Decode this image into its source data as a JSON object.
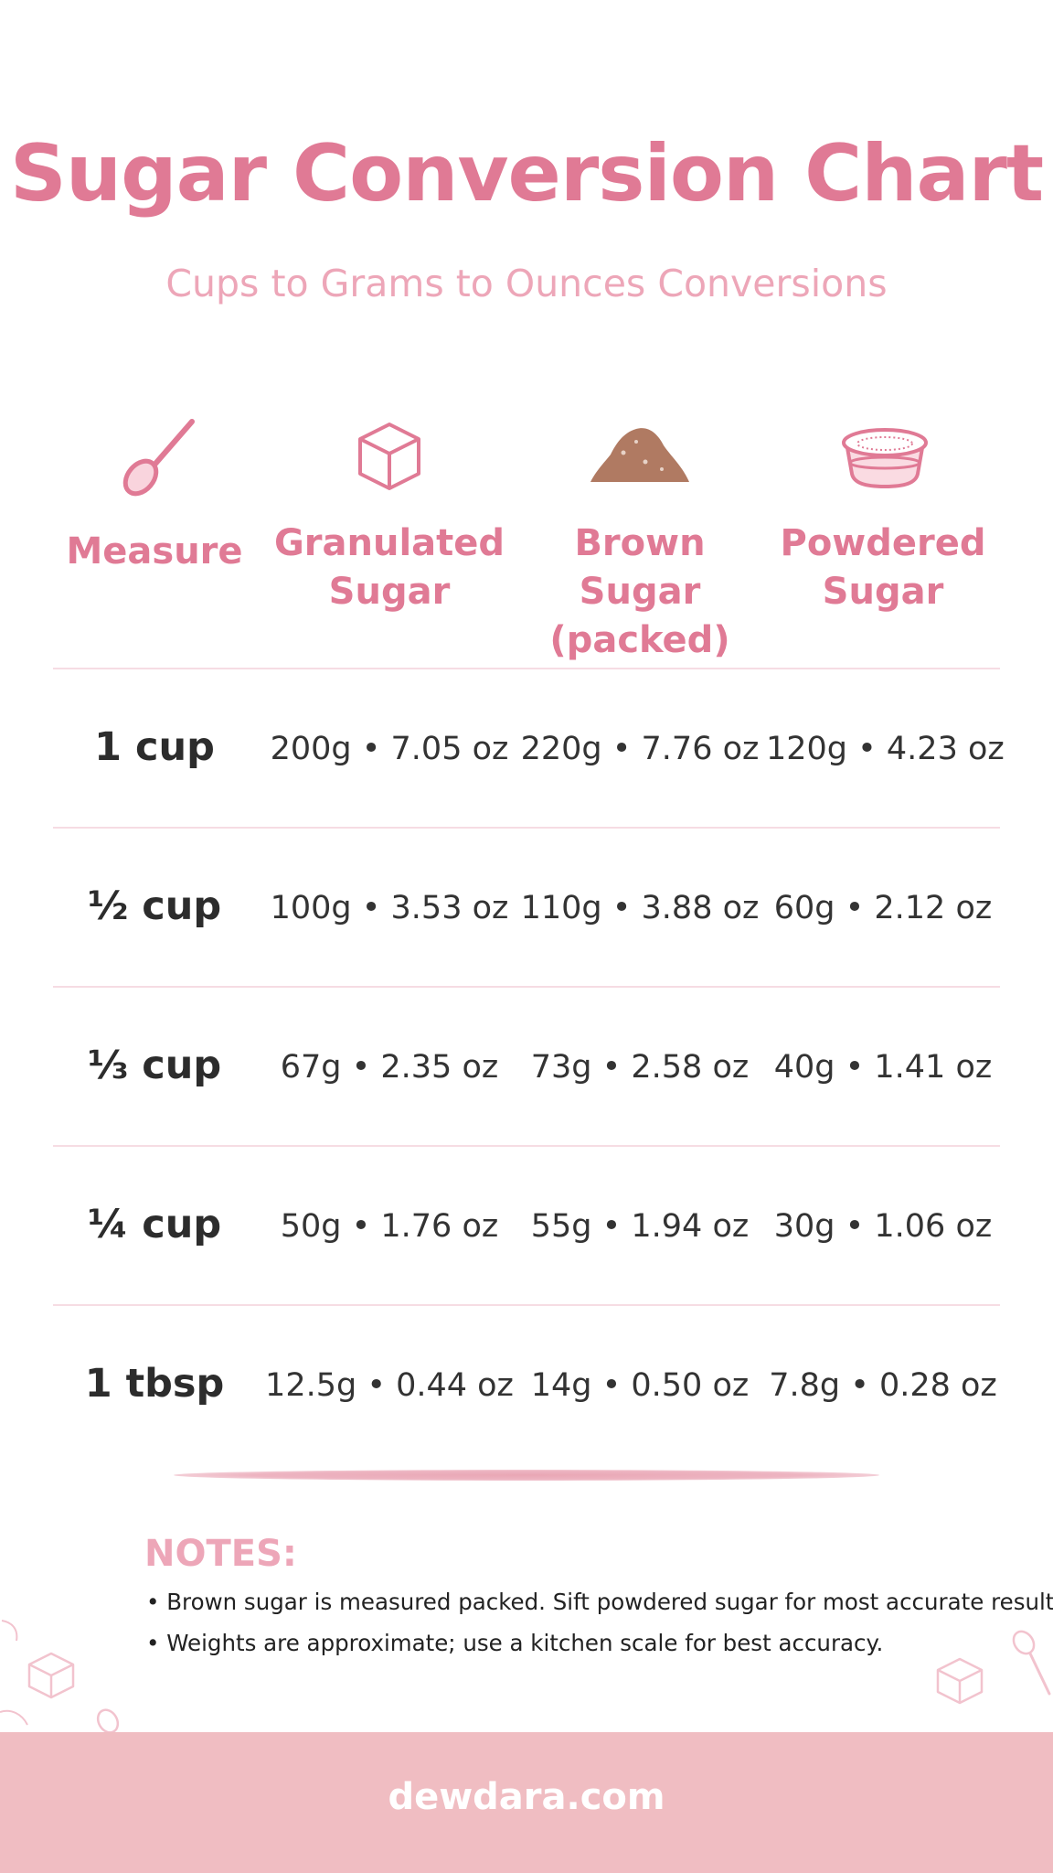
{
  "header": {
    "title": "Sugar Conversion Chart",
    "subtitle": "Cups to Grams to Ounces Conversions"
  },
  "columns": [
    {
      "icon": "spoon-icon",
      "lines": [
        "Measure"
      ]
    },
    {
      "icon": "sugar-cube-icon",
      "lines": [
        "Granulated",
        "Sugar"
      ]
    },
    {
      "icon": "brown-sugar-pile-icon",
      "lines": [
        "Brown Sugar",
        "(packed)"
      ]
    },
    {
      "icon": "powdered-sugar-bowl-icon",
      "lines": [
        "Powdered",
        "Sugar"
      ]
    }
  ],
  "rows": [
    {
      "measure": "1 cup",
      "granulated": "200g • 7.05 oz",
      "brown": "220g • 7.76 oz",
      "powdered": "120g • 4.23 oz"
    },
    {
      "measure": "½ cup",
      "granulated": "100g • 3.53 oz",
      "brown": "110g • 3.88 oz",
      "powdered": "60g • 2.12 oz"
    },
    {
      "measure": "⅓ cup",
      "granulated": "67g • 2.35 oz",
      "brown": "73g • 2.58 oz",
      "powdered": "40g • 1.41 oz"
    },
    {
      "measure": "¼ cup",
      "granulated": "50g • 1.76 oz",
      "brown": "55g • 1.94 oz",
      "powdered": "30g • 1.06 oz"
    },
    {
      "measure": "1 tbsp",
      "granulated": "12.5g • 0.44 oz",
      "brown": "14g • 0.50 oz",
      "powdered": "7.8g • 0.28 oz"
    }
  ],
  "notes": {
    "title": "NOTES:",
    "items": [
      "• Brown sugar is measured packed. Sift powdered sugar for most accurate results.",
      "• Weights are approximate; use a kitchen scale for best accuracy."
    ]
  },
  "footer": {
    "site": "dewdara.com"
  },
  "colors": {
    "accent": "#E07A95",
    "accent_light": "#EDA6B8",
    "footer_bg": "#F0BDC2",
    "brown_sugar": "#B07A62",
    "text": "#333333"
  }
}
